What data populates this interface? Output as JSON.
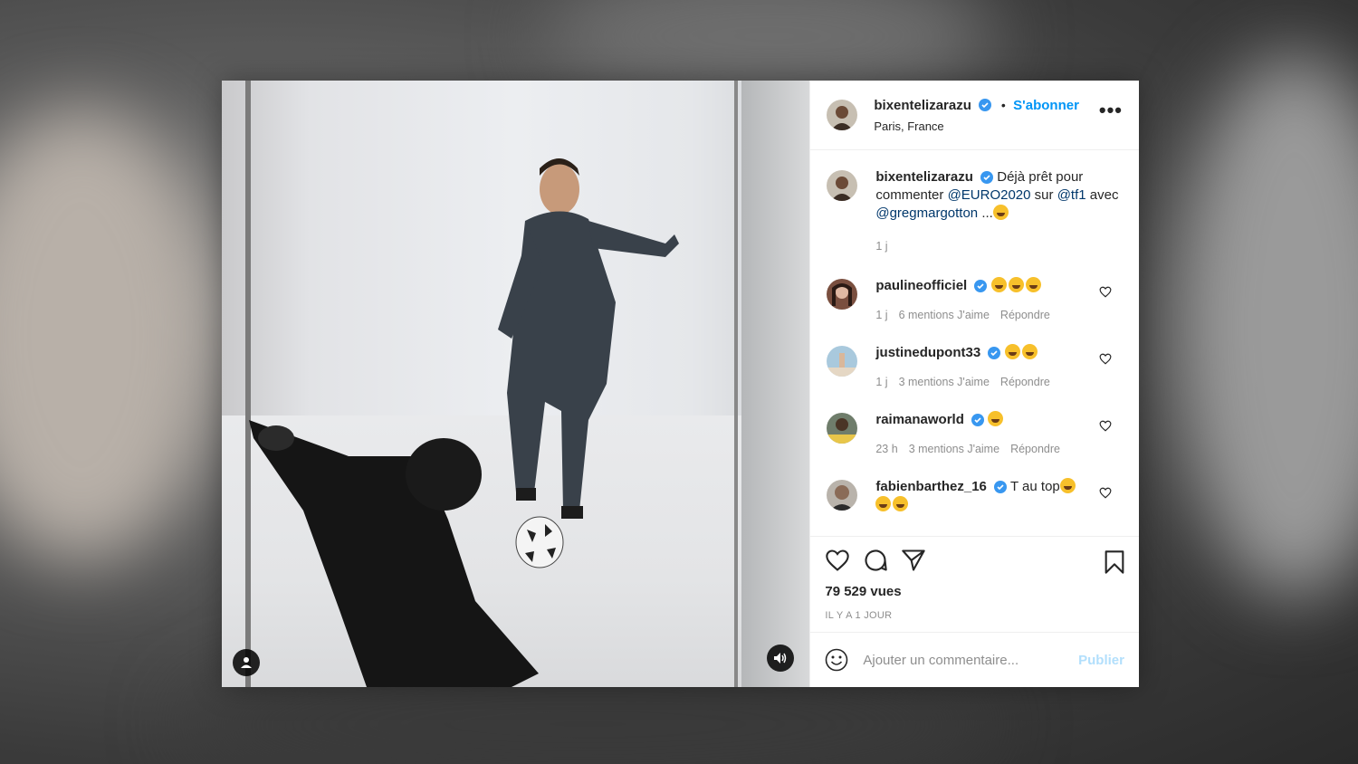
{
  "post": {
    "username": "bixentelizarazu",
    "follow_label": "S'abonner",
    "location": "Paris, France",
    "more_label": "•••"
  },
  "caption": {
    "username": "bixentelizarazu",
    "text_1": "Déjà prêt pour commenter ",
    "mention_1": "@EURO2020",
    "text_2": " sur ",
    "mention_2": "@tf1",
    "text_3": " avec ",
    "mention_3": "@gregmargotton",
    "text_4": " ...",
    "time": "1 j"
  },
  "comments": [
    {
      "username": "paulineofficiel",
      "text": "",
      "emoji_count": 3,
      "time": "1 j",
      "likes": "6 mentions J'aime",
      "reply": "Répondre"
    },
    {
      "username": "justinedupont33",
      "text": "",
      "emoji_count": 2,
      "time": "1 j",
      "likes": "3 mentions J'aime",
      "reply": "Répondre"
    },
    {
      "username": "raimanaworld",
      "text": "",
      "emoji_count": 1,
      "time": "23 h",
      "likes": "3 mentions J'aime",
      "reply": "Répondre"
    },
    {
      "username": "fabienbarthez_16",
      "text": "T au top",
      "emoji_count": 3,
      "time": "",
      "likes": "",
      "reply": ""
    }
  ],
  "stats": {
    "views": "79 529 vues",
    "posted": "IL Y A 1 JOUR"
  },
  "composer": {
    "placeholder": "Ajouter un commentaire...",
    "publish": "Publier"
  },
  "icons": {
    "verified": "verified-badge-icon",
    "like": "heart-icon",
    "comment": "comment-bubble-icon",
    "share": "paper-plane-icon",
    "save": "bookmark-icon",
    "emoji": "smiley-icon",
    "sound": "speaker-icon",
    "tags": "user-tag-icon"
  },
  "colors": {
    "accent": "#0095f6",
    "publish_disabled": "#b2dffc",
    "muted": "#8e8e8e",
    "text": "#262626"
  }
}
